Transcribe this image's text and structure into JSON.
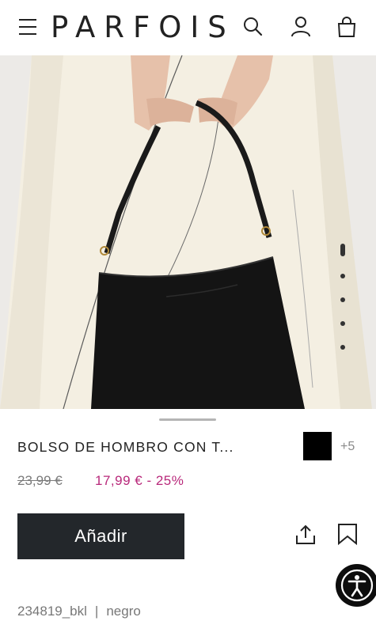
{
  "header": {
    "brand": "PARFOIS",
    "icons": [
      "menu-icon",
      "search-icon",
      "user-icon",
      "bag-icon"
    ]
  },
  "gallery": {
    "image_alt": "black shoulder bag",
    "slide_count": 5,
    "active_slide": 1
  },
  "product": {
    "title": "BOLSO DE HOMBRO CON T...",
    "color_swatch": "#000000",
    "more_colors": "+5",
    "old_price": "23,99 €",
    "new_price": "17,99 € - 25%",
    "add_label": "Añadir",
    "reference": "234819_bkl",
    "separator": "|",
    "color_name": "negro"
  },
  "colors": {
    "sale": "#b8287a",
    "button_bg": "#23272b",
    "text": "#222222"
  }
}
